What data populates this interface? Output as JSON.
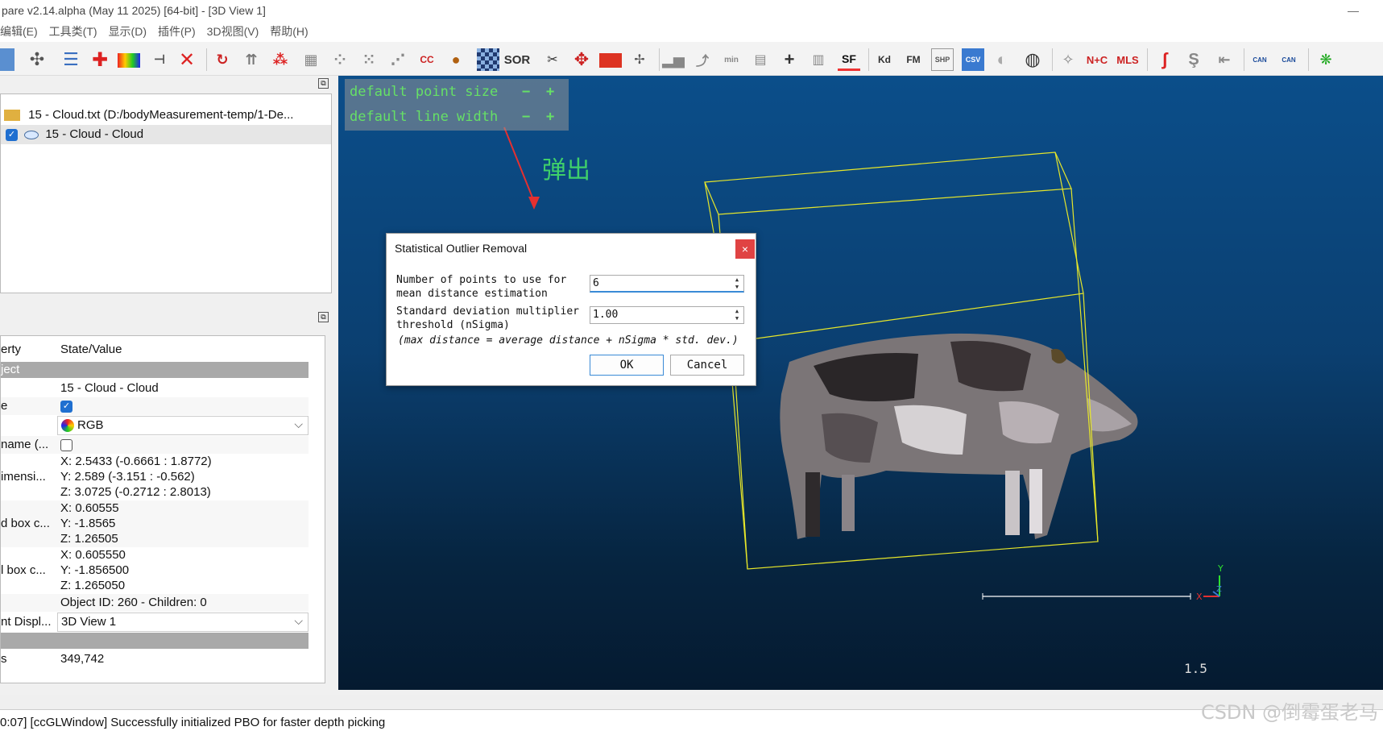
{
  "window": {
    "title": "pare v2.14.alpha (May 11 2025) [64-bit] - [3D View 1]"
  },
  "menu": [
    "编辑(E)",
    "工具类(T)",
    "显示(D)",
    "插件(P)",
    "3D视图(V)",
    "帮助(H)"
  ],
  "toolbar": {
    "sor_label": "SOR",
    "cc_label": "CC",
    "sf_label": "SF",
    "kd_label": "Kd",
    "fm_label": "FM",
    "shp_label": "SHP",
    "csv_label": "CSV",
    "nc_label": "N+C",
    "mls_label": "MLS"
  },
  "db_tree": {
    "items": [
      {
        "label": "15 - Cloud.txt (D:/bodyMeasurement-temp/1-De..."
      },
      {
        "label": "15 - Cloud - Cloud"
      }
    ]
  },
  "properties": {
    "headers": [
      "erty",
      "State/Value"
    ],
    "section_object": "ject",
    "rows": [
      {
        "key": "",
        "value": "15 - Cloud - Cloud"
      },
      {
        "key": "e",
        "value": ""
      },
      {
        "key": "",
        "value": "RGB"
      },
      {
        "key": "name (...",
        "value": ""
      },
      {
        "key": "imensi...",
        "lines": [
          "X: 2.5433 (-0.6661 : 1.8772)",
          "Y: 2.589 (-3.151 : -0.562)",
          "Z: 3.0725 (-0.2712 : 2.8013)"
        ]
      },
      {
        "key": "d box c...",
        "lines": [
          "X: 0.60555",
          "Y: -1.8565",
          "Z: 1.26505"
        ]
      },
      {
        "key": "l box c...",
        "lines": [
          "X: 0.605550",
          "Y: -1.856500",
          "Z: 1.265050"
        ]
      },
      {
        "key": "",
        "value": "Object ID: 260 - Children: 0"
      },
      {
        "key": "nt Displ...",
        "value": "3D View 1"
      },
      {
        "key": "s",
        "value": "349,742"
      }
    ]
  },
  "hud": {
    "point_size_label": "default point size",
    "line_width_label": "default line width",
    "minus": "−",
    "plus": "+"
  },
  "annotation": "弹出",
  "view": {
    "scale_label": "1.5",
    "axis_y": "Y",
    "axis_x": "X",
    "axis_z": "Z"
  },
  "dialog": {
    "title": "Statistical Outlier Removal",
    "close": "×",
    "points_label": "Number of points to use for mean distance estimation",
    "points_value": "6",
    "nsigma_label": "Standard deviation multiplier threshold (nSigma)",
    "nsigma_value": "1.00",
    "note": "(max distance = average distance + nSigma * std. dev.)",
    "ok": "OK",
    "cancel": "Cancel"
  },
  "console": {
    "text": "0:07] [ccGLWindow] Successfully initialized PBO for faster depth picking"
  },
  "watermark": "CSDN @倒霉蛋老马",
  "colors": {
    "hud_text": "#66e066",
    "highlight": "#e53030",
    "bbox": "#e6e62a",
    "checkbox": "#1f6fd0"
  }
}
